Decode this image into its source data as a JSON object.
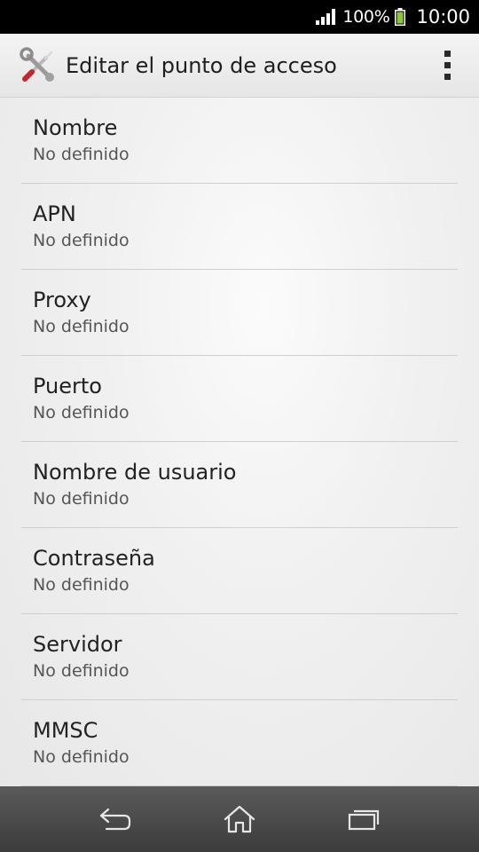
{
  "status_bar": {
    "battery_percent": "100%",
    "time": "10:00",
    "icons": [
      "signal-icon",
      "battery-icon"
    ]
  },
  "action_bar": {
    "title": "Editar el punto de acceso",
    "icons": [
      "settings-tools-icon",
      "overflow-menu-icon"
    ]
  },
  "preferences": [
    {
      "title": "Nombre",
      "summary": "No definido"
    },
    {
      "title": "APN",
      "summary": "No definido"
    },
    {
      "title": "Proxy",
      "summary": "No definido"
    },
    {
      "title": "Puerto",
      "summary": "No definido"
    },
    {
      "title": "Nombre de usuario",
      "summary": "No definido"
    },
    {
      "title": "Contraseña",
      "summary": "No definido"
    },
    {
      "title": "Servidor",
      "summary": "No definido"
    },
    {
      "title": "MMSC",
      "summary": "No definido"
    }
  ],
  "nav_bar": {
    "icons": [
      "back-icon",
      "home-icon",
      "recent-apps-icon"
    ]
  },
  "colors": {
    "battery": "#8cc63f",
    "action_bar_bg": "#eeeeee",
    "nav_bar_bg": "#4a4a4a"
  }
}
